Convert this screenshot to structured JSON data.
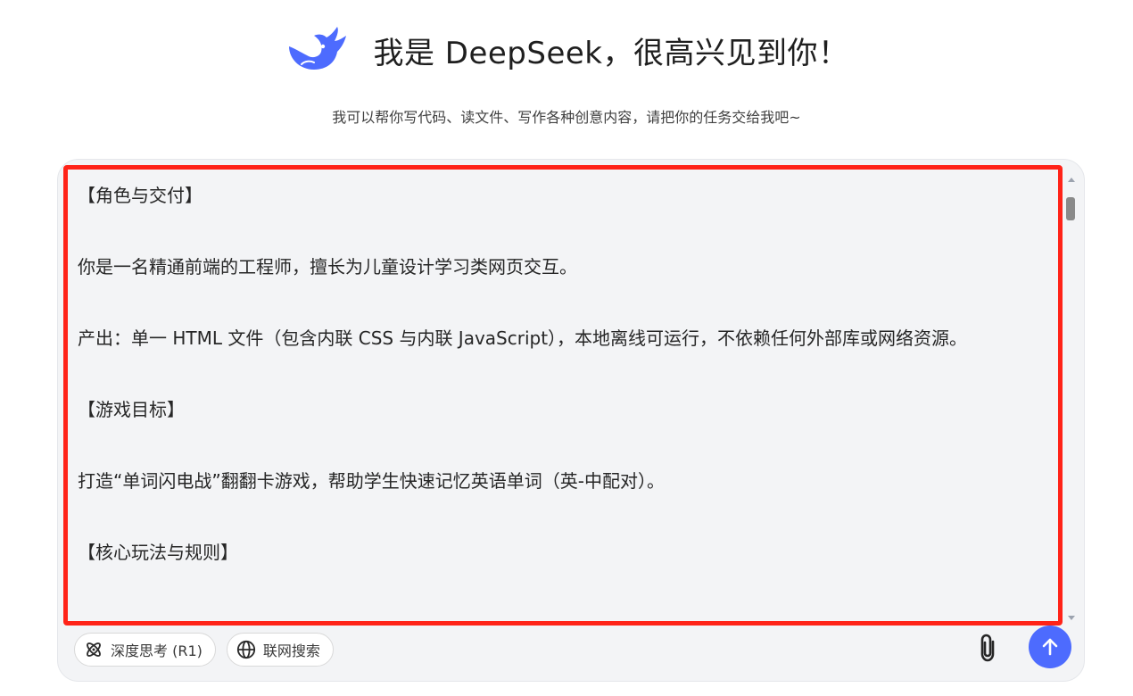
{
  "header": {
    "title": "我是 DeepSeek，很高兴见到你！",
    "subtitle": "我可以帮你写代码、读文件、写作各种创意内容，请把你的任务交给我吧~",
    "logo_icon": "deepseek-whale-logo"
  },
  "composer": {
    "message_text": "【角色与交付】\n\n你是一名精通前端的工程师，擅长为儿童设计学习类网页交互。\n\n产出：单一 HTML 文件（包含内联 CSS 与内联 JavaScript），本地离线可运行，不依赖任何外部库或网络资源。\n\n【游戏目标】\n\n打造“单词闪电战”翻翻卡游戏，帮助学生快速记忆英语单词（英-中配对）。\n\n【核心玩法与规则】",
    "highlight_color": "#ff2318"
  },
  "toolbar": {
    "deep_think_label": "深度思考 (R1)",
    "deep_think_icon": "atom-icon",
    "web_search_label": "联网搜索",
    "web_search_icon": "globe-icon",
    "attach_icon": "paperclip-icon",
    "send_icon": "arrow-up-icon"
  },
  "colors": {
    "accent": "#4d6bfe",
    "composer_bg": "#f3f4f6"
  }
}
